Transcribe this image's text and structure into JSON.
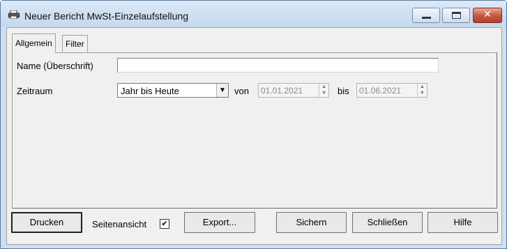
{
  "window": {
    "title": "Neuer Bericht MwSt-Einzelaufstellung",
    "controls": {
      "minimize": "minimize-icon",
      "maximize": "maximize-icon",
      "close": "close-icon",
      "close_glyph": "✕"
    }
  },
  "tabs": [
    {
      "label": "Allgemein",
      "active": true
    },
    {
      "label": "Filter",
      "active": false
    }
  ],
  "form": {
    "name_label": "Name (Überschrift)",
    "name_value": "",
    "period_label": "Zeitraum",
    "period_selected": "Jahr bis Heute",
    "from_label": "von",
    "from_date": "01.01.2021",
    "to_label": "bis",
    "to_date": "01.06.2021"
  },
  "footer": {
    "print_label": "Drucken",
    "preview_label": "Seitenansicht",
    "preview_checked": true,
    "export_label": "Export...",
    "save_label": "Sichern",
    "close_label": "Schließen",
    "help_label": "Hilfe"
  }
}
